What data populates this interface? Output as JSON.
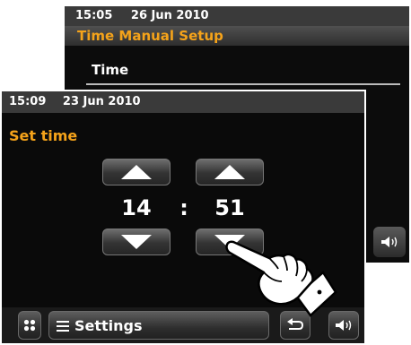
{
  "back_screen": {
    "time": "15:05",
    "date": "26 Jun 2010",
    "title": "Time Manual Setup",
    "item": "Time",
    "volume_icon": "speaker-icon"
  },
  "front_screen": {
    "time": "15:09",
    "date": "23 Jun 2010",
    "title": "Set time",
    "hours": "14",
    "separator": ":",
    "minutes": "51",
    "bottom_bar": {
      "home_icon": "grid-icon",
      "menu_icon": "list-icon",
      "menu_label": "Settings",
      "back_icon": "return-icon",
      "volume_icon": "speaker-icon"
    }
  },
  "colors": {
    "accent": "#f5a31a",
    "background": "#0a0a0a",
    "status_bar": "#3a3a3a"
  }
}
